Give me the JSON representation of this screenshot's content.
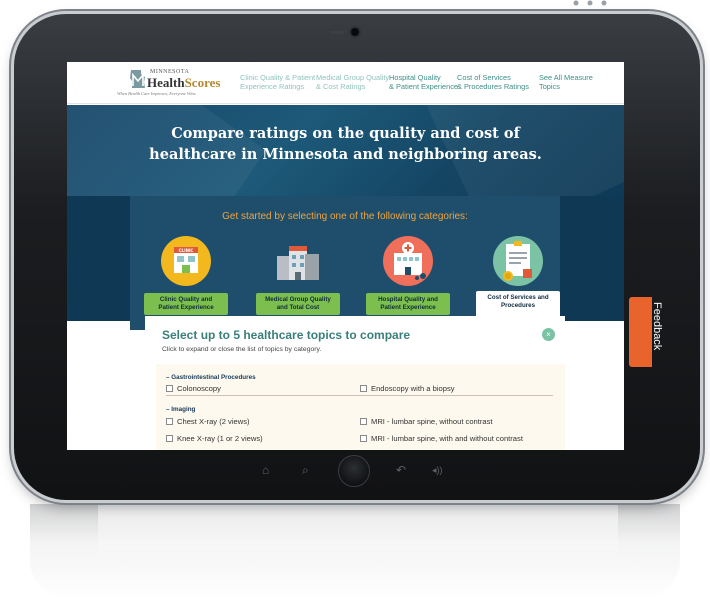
{
  "header": {
    "logo": {
      "state": "MINNESOTA",
      "name_part1": "Health",
      "name_part2": "Scores",
      "tagline": "When Health Care Improves, Everyone Wins."
    },
    "nav": [
      {
        "label": "Clinic Quality & Patient\nExperience Ratings"
      },
      {
        "label": "Medical Group Quality\n& Cost Ratings"
      },
      {
        "label": "Hospital Quality\n& Patient Experience"
      },
      {
        "label": "Cost of Services\n& Procedures Ratings"
      },
      {
        "label": "See All Measure\nTopics"
      }
    ]
  },
  "hero": {
    "title": "Compare ratings on the quality and cost of\nhealthcare in Minnesota and neighboring areas."
  },
  "categories": {
    "prompt": "Get started by selecting one of the following categories:",
    "items": [
      {
        "label": "Clinic Quality and\nPatient Experience",
        "icon": "clinic-building-icon",
        "selected": false
      },
      {
        "label": "Medical Group Quality\nand Total Cost",
        "icon": "medical-group-buildings-icon",
        "selected": false
      },
      {
        "label": "Hospital Quality and\nPatient Experience",
        "icon": "hospital-icon",
        "selected": false
      },
      {
        "label": "Cost of Services and\nProcedures",
        "icon": "cost-document-icon",
        "selected": true
      }
    ],
    "clinic_sign": "CLINIC"
  },
  "selector": {
    "title": "Select up to 5 healthcare topics to compare",
    "subtitle": "Click to expand or close the list of topics by category.",
    "groups": [
      {
        "name": "– Gastrointestinal Procedures",
        "items": [
          {
            "label": "Colonoscopy"
          },
          {
            "label": "Endoscopy with a biopsy"
          }
        ]
      },
      {
        "name": "– Imaging",
        "items": [
          {
            "label": "Chest X-ray (2 views)"
          },
          {
            "label": "MRI - lumbar spine, without contrast"
          },
          {
            "label": "Knee X-ray (1 or 2 views)"
          },
          {
            "label": "MRI - lumbar spine, with and without contrast"
          }
        ]
      }
    ]
  },
  "feedback": {
    "label": "Feedback"
  },
  "colors": {
    "accent_teal": "#3c8f87",
    "category_green": "#7cbf4e",
    "prompt_orange": "#f2a33a",
    "feedback_orange": "#e8642c",
    "hero_blue": "#19486a"
  }
}
